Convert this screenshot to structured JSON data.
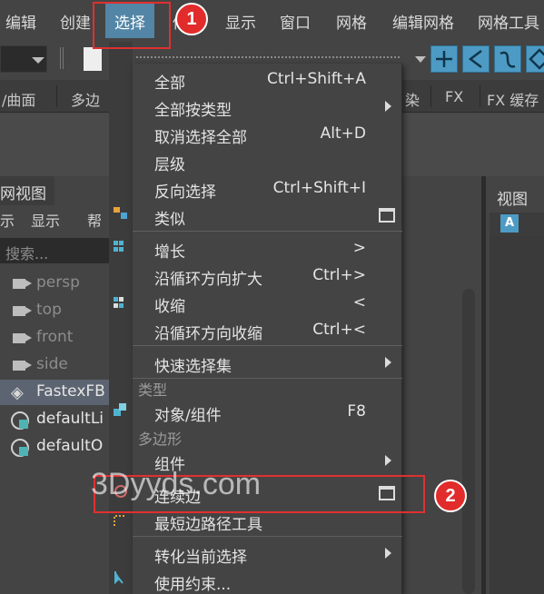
{
  "menubar": {
    "items": [
      {
        "label": "编辑"
      },
      {
        "label": "创建"
      },
      {
        "label": "选择",
        "active": true
      },
      {
        "label": "修"
      },
      {
        "label": "显示"
      },
      {
        "label": "窗口"
      },
      {
        "label": "网格"
      },
      {
        "label": "编辑网格"
      },
      {
        "label": "网格工具"
      }
    ]
  },
  "shelf": {
    "tabs": [
      "/曲面",
      "多边",
      "染",
      "FX",
      "FX 缓存"
    ]
  },
  "outliner": {
    "tab_label": "网视图",
    "menu": [
      "示",
      "显示",
      "帮"
    ],
    "search_placeholder": "搜索...",
    "items": [
      {
        "label": "persp",
        "kind": "camera"
      },
      {
        "label": "top",
        "kind": "camera"
      },
      {
        "label": "front",
        "kind": "camera"
      },
      {
        "label": "side",
        "kind": "camera"
      },
      {
        "label": "FastexFB",
        "kind": "group",
        "selected": true
      },
      {
        "label": "defaultLi",
        "kind": "set"
      },
      {
        "label": "defaultO",
        "kind": "set"
      }
    ]
  },
  "right_panel": {
    "view_tab": "视图",
    "a_icon": "A"
  },
  "menu": {
    "items": [
      {
        "label": "全部",
        "shortcut": "Ctrl+Shift+A"
      },
      {
        "label": "全部按类型",
        "submenu": true
      },
      {
        "label": "取消选择全部",
        "shortcut": "Alt+D"
      },
      {
        "label": "层级"
      },
      {
        "label": "反向选择",
        "shortcut": "Ctrl+Shift+I"
      },
      {
        "label": "类似",
        "option_box": true
      },
      {
        "label": "增长",
        "shortcut": ">"
      },
      {
        "label": "沿循环方向扩大",
        "shortcut": "Ctrl+>"
      },
      {
        "label": "收缩",
        "shortcut": "<"
      },
      {
        "label": "沿循环方向收缩",
        "shortcut": "Ctrl+<"
      },
      {
        "label": "快速选择集",
        "submenu": true
      },
      {
        "label": "对象/组件",
        "shortcut": "F8"
      },
      {
        "label": "组件",
        "submenu": true
      },
      {
        "label": "连续边",
        "option_box": true
      },
      {
        "label": "最短边路径工具"
      },
      {
        "label": "转化当前选择",
        "submenu": true
      },
      {
        "label": "使用约束..."
      }
    ],
    "sections": [
      "类型",
      "多边形"
    ]
  },
  "annotations": {
    "badge1": "1",
    "badge2": "2",
    "color": "#e03030"
  },
  "watermark": "3Dyyds.com"
}
